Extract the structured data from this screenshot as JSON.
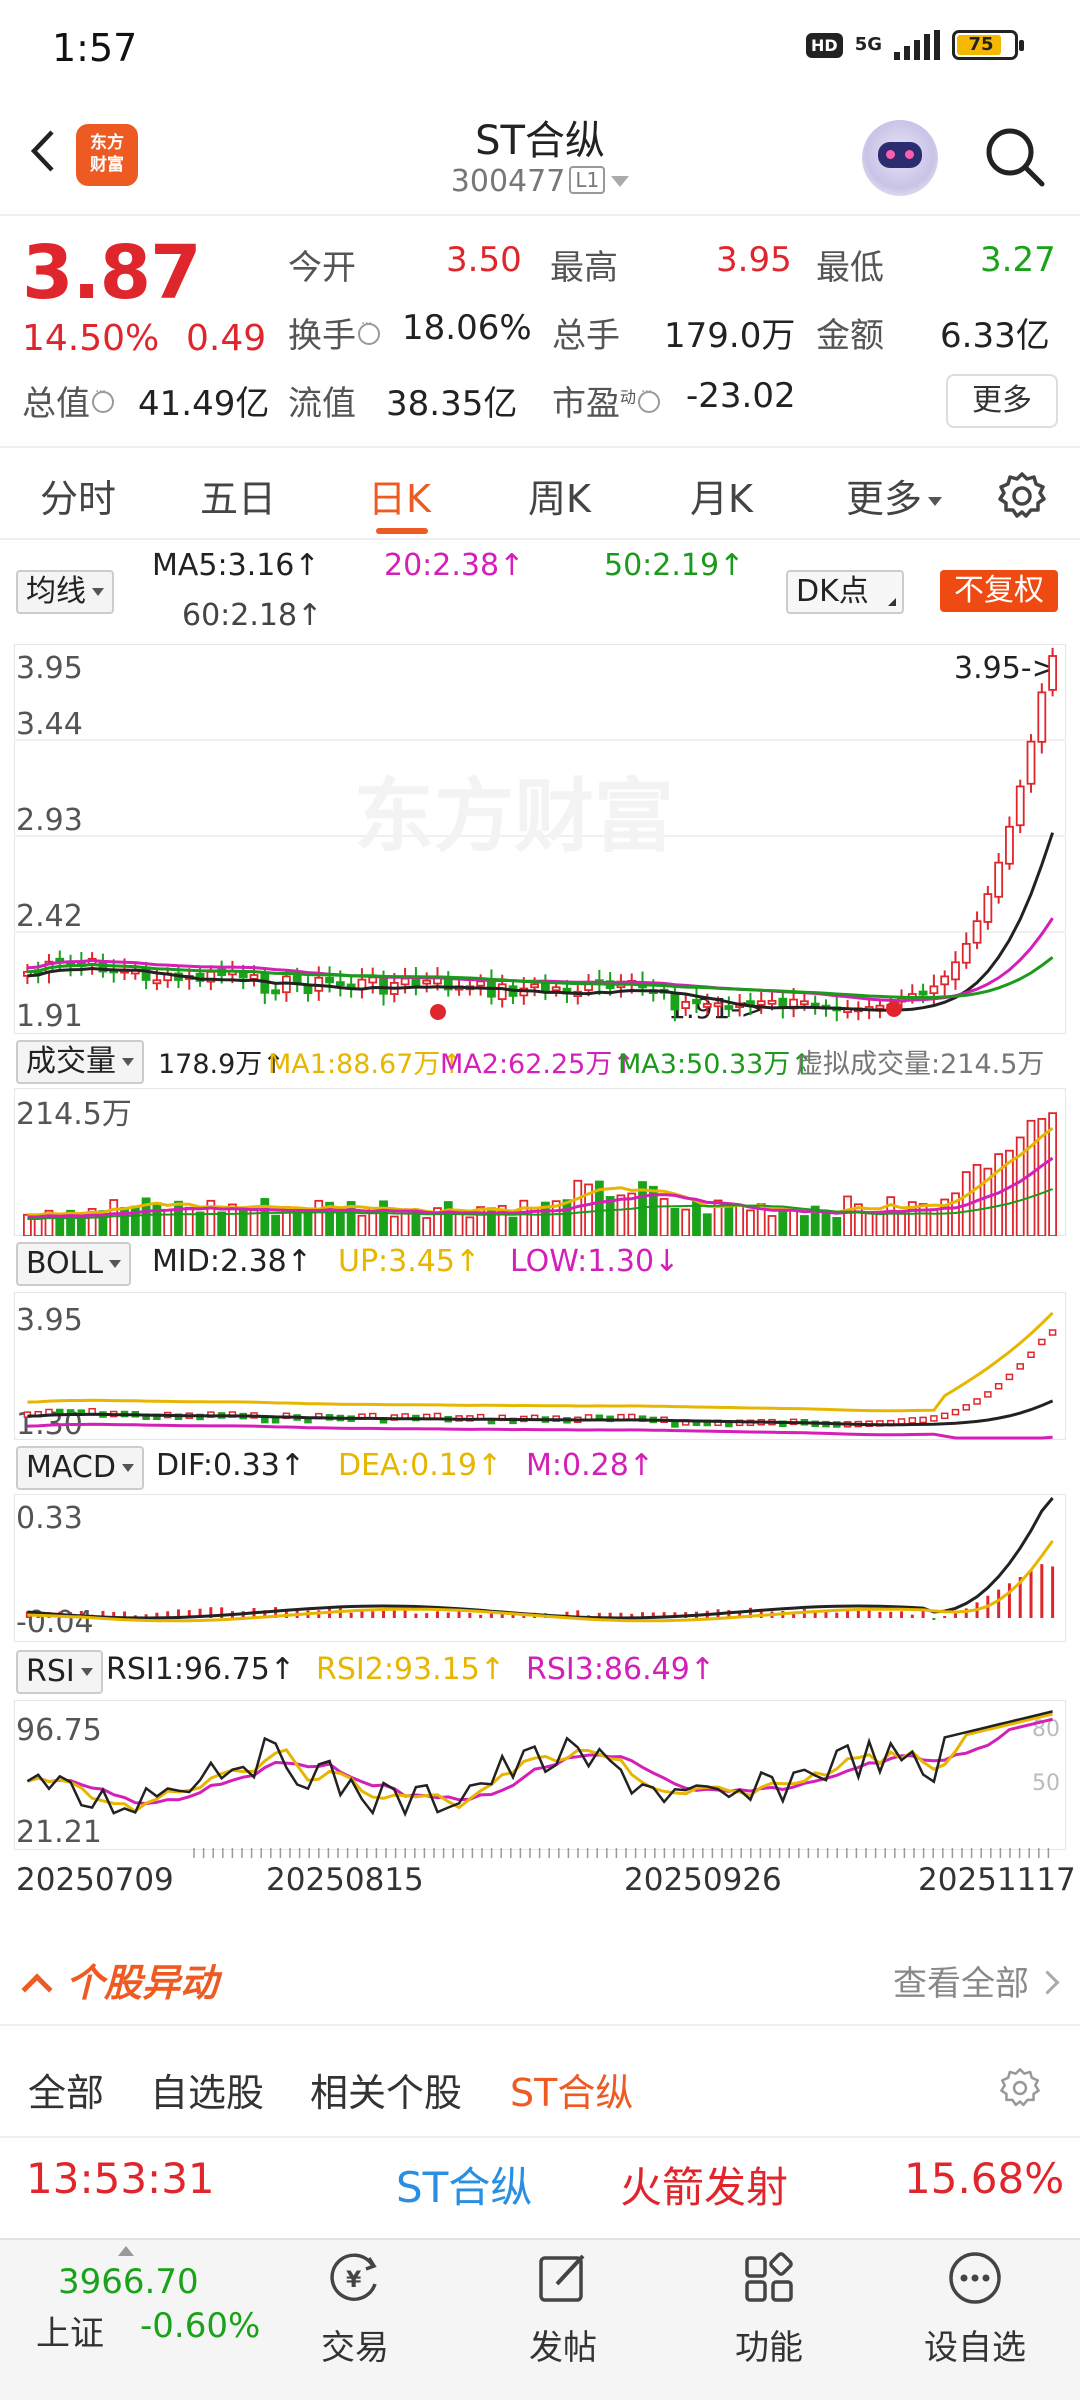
{
  "status_bar": {
    "time": "1:57",
    "hd": "HD",
    "network": "5G",
    "battery": "75"
  },
  "header": {
    "logo_text": "东方财富",
    "stock_name": "ST合纵",
    "stock_code": "300477",
    "level": "L1"
  },
  "quote": {
    "price": "3.87",
    "change_pct": "14.50%",
    "change": "0.49",
    "open_label": "今开",
    "open": "3.50",
    "high_label": "最高",
    "high": "3.95",
    "low_label": "最低",
    "low": "3.27",
    "turnover_label": "换手",
    "turnover": "18.06%",
    "volume_label": "总手",
    "volume": "179.0万",
    "amount_label": "金额",
    "amount": "6.33亿",
    "mktcap_label": "总值",
    "mktcap": "41.49亿",
    "float_label": "流值",
    "float": "38.35亿",
    "pe_label": "市盈",
    "pe_sup": "动",
    "pe": "-23.02",
    "more_button": "更多"
  },
  "tabs": [
    "分时",
    "五日",
    "日K",
    "周K",
    "月K",
    "更多"
  ],
  "tabs_active": "日K",
  "ma_bar": {
    "selector": "均线",
    "ma5": "MA5:3.16↑",
    "ma20": "20:2.38↑",
    "ma50": "50:2.19↑",
    "ma60": "60:2.18↑",
    "dk_button": "DK点",
    "fq_button": "不复权"
  },
  "kline": {
    "y_labels": [
      "3.95",
      "3.44",
      "2.93",
      "2.42",
      "1.91"
    ],
    "high_marker": "3.95->",
    "low_marker": "1.91->",
    "watermark": "东方财富"
  },
  "volume_bar": {
    "selector": "成交量",
    "value": "178.9万↑",
    "ma1": "MA1:88.67万↑",
    "ma2": "MA2:62.25万↑",
    "ma3": "MA3:50.33万↑",
    "virtual": "虚拟成交量:214.5万",
    "y_top": "214.5万"
  },
  "boll_bar": {
    "selector": "BOLL",
    "mid": "MID:2.38↑",
    "up": "UP:3.45↑",
    "low": "LOW:1.30↓",
    "y_top": "3.95",
    "y_bottom": "1.30"
  },
  "macd_bar": {
    "selector": "MACD",
    "dif": "DIF:0.33↑",
    "dea": "DEA:0.19↑",
    "m": "M:0.28↑",
    "y_top": "0.33",
    "y_bottom": "-0.04"
  },
  "rsi_bar": {
    "selector": "RSI",
    "rsi1": "RSI1:96.75↑",
    "rsi2": "RSI2:93.15↑",
    "rsi3": "RSI3:86.49↑",
    "y_top": "96.75",
    "y_bottom": "21.21",
    "level_80": "80",
    "level_50": "50"
  },
  "x_dates": [
    "20250709",
    "20250815",
    "20250926",
    "20251117"
  ],
  "movers": {
    "title": "个股异动",
    "view_all": "查看全部",
    "tabs": [
      "全部",
      "自选股",
      "相关个股",
      "ST合纵"
    ],
    "active_tab": "ST合纵",
    "row": {
      "time": "13:53:31",
      "name": "ST合纵",
      "event": "火箭发射",
      "pct": "15.68%"
    }
  },
  "bottom_bar": {
    "index_value": "3966.70",
    "index_name": "上证",
    "index_change": "-0.60%",
    "nav": [
      "交易",
      "发帖",
      "功能",
      "设自选"
    ]
  },
  "colors": {
    "accent": "#ee5b22",
    "up": "#e0262d",
    "down": "#1aa21a",
    "ma20": "#d41fb8",
    "ma50": "#1b9a1b",
    "yellow": "#e7b600"
  }
}
